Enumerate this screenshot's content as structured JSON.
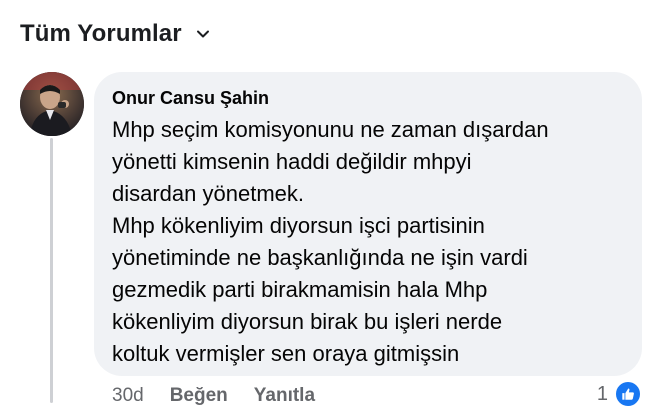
{
  "filter": {
    "label": "Tüm Yorumlar",
    "icon": "chevron-down-icon"
  },
  "comment": {
    "author": "Onur Cansu Şahin",
    "text": "Mhp seçim komisyonunu ne zaman dışardan\nyönetti kimsenin haddi değildir mhpyi\ndisardan yönetmek.\nMhp kökenliyim diyorsun işci partisinin\nyönetiminde ne başkanlığında ne işin vardi\ngezmedik parti birakmamisin hala Mhp\nkökenliyim diyorsun birak bu işleri nerde\nkoltuk vermişler sen oraya gitmişsin",
    "time": "30d",
    "like_label": "Beğen",
    "reply_label": "Yanıtla",
    "reaction_count": "1",
    "reaction_icon": "like-icon"
  },
  "colors": {
    "bubble_bg": "#f0f2f5",
    "meta_text": "#65676b",
    "like_blue": "#1877f2"
  }
}
